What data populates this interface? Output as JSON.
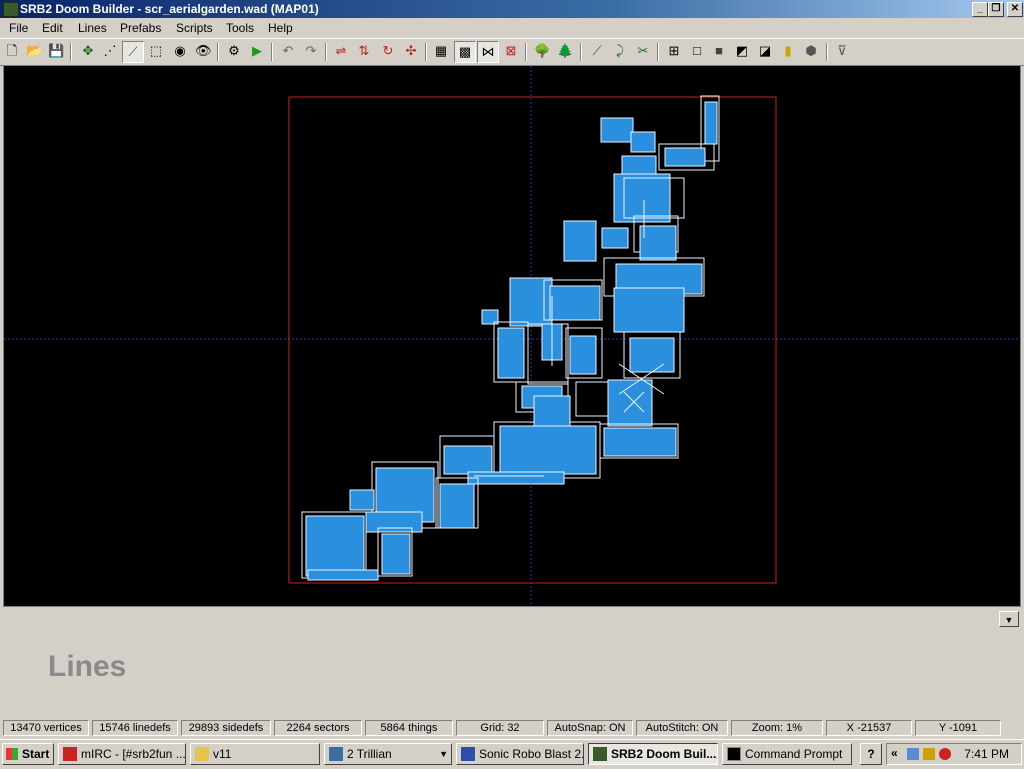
{
  "window": {
    "title": "SRB2 Doom Builder - scr_aerialgarden.wad (MAP01)"
  },
  "menu": [
    "File",
    "Edit",
    "Lines",
    "Prefabs",
    "Scripts",
    "Tools",
    "Help"
  ],
  "mode_label": "Lines",
  "status": {
    "vertices": "13470 vertices",
    "linedefs": "15746 linedefs",
    "sidedefs": "29893 sidedefs",
    "sectors": "2264 sectors",
    "things": "5864 things",
    "grid": "Grid: 32",
    "autosnap": "AutoSnap: ON",
    "autostitch": "AutoStitch: ON",
    "zoom": "Zoom: 1%",
    "x": "X -21537",
    "y": "Y -1091"
  },
  "taskbar": {
    "start": "Start",
    "tasks": [
      "mIRC - [#srb2fun ...",
      "v11",
      "2 Trillian",
      "Sonic Robo Blast 2...",
      "SRB2 Doom Buil...",
      "Command Prompt"
    ],
    "help_icon": "?",
    "tray_chevron": "«",
    "clock": "7:41 PM"
  },
  "colors": {
    "linedef": "#2a8fdc",
    "boundary": "#cc1f1f",
    "axis": "#3a2aa8",
    "canvas": "#000000"
  }
}
